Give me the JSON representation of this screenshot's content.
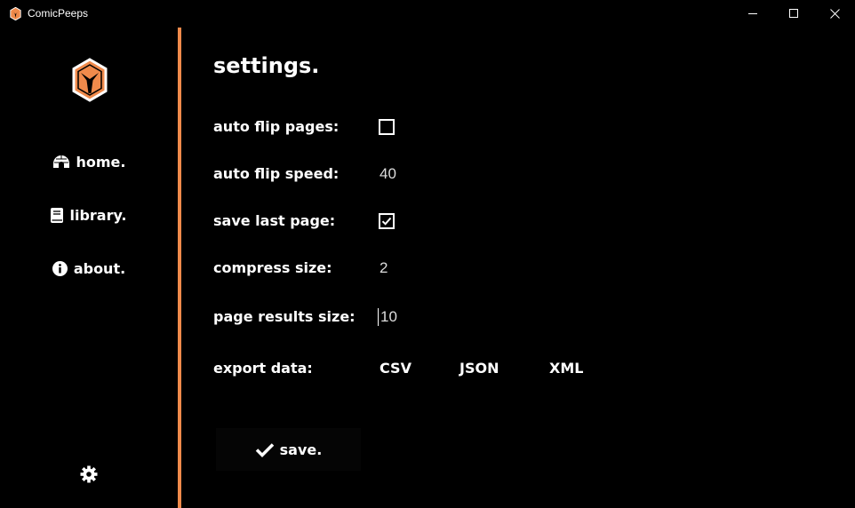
{
  "window": {
    "title": "ComicPeeps"
  },
  "sidebar": {
    "items": [
      {
        "label": "home.",
        "icon": "igloo-icon"
      },
      {
        "label": "library.",
        "icon": "book-icon"
      },
      {
        "label": "about.",
        "icon": "info-circle-icon"
      }
    ],
    "settings_icon": "gear-icon"
  },
  "colors": {
    "accent": "#f08a4b",
    "background": "#000000",
    "text": "#ffffff"
  },
  "settings": {
    "title": "settings.",
    "auto_flip_pages": {
      "label": "auto flip pages:",
      "checked": false
    },
    "auto_flip_speed": {
      "label": "auto flip speed:",
      "value": "40"
    },
    "save_last_page": {
      "label": "save last page:",
      "checked": true
    },
    "compress_size": {
      "label": "compress size:",
      "value": "2"
    },
    "page_results_size": {
      "label": "page results size:",
      "value": "10"
    },
    "export_data": {
      "label": "export data:",
      "options": [
        "CSV",
        "JSON",
        "XML"
      ]
    },
    "save_label": "save."
  }
}
